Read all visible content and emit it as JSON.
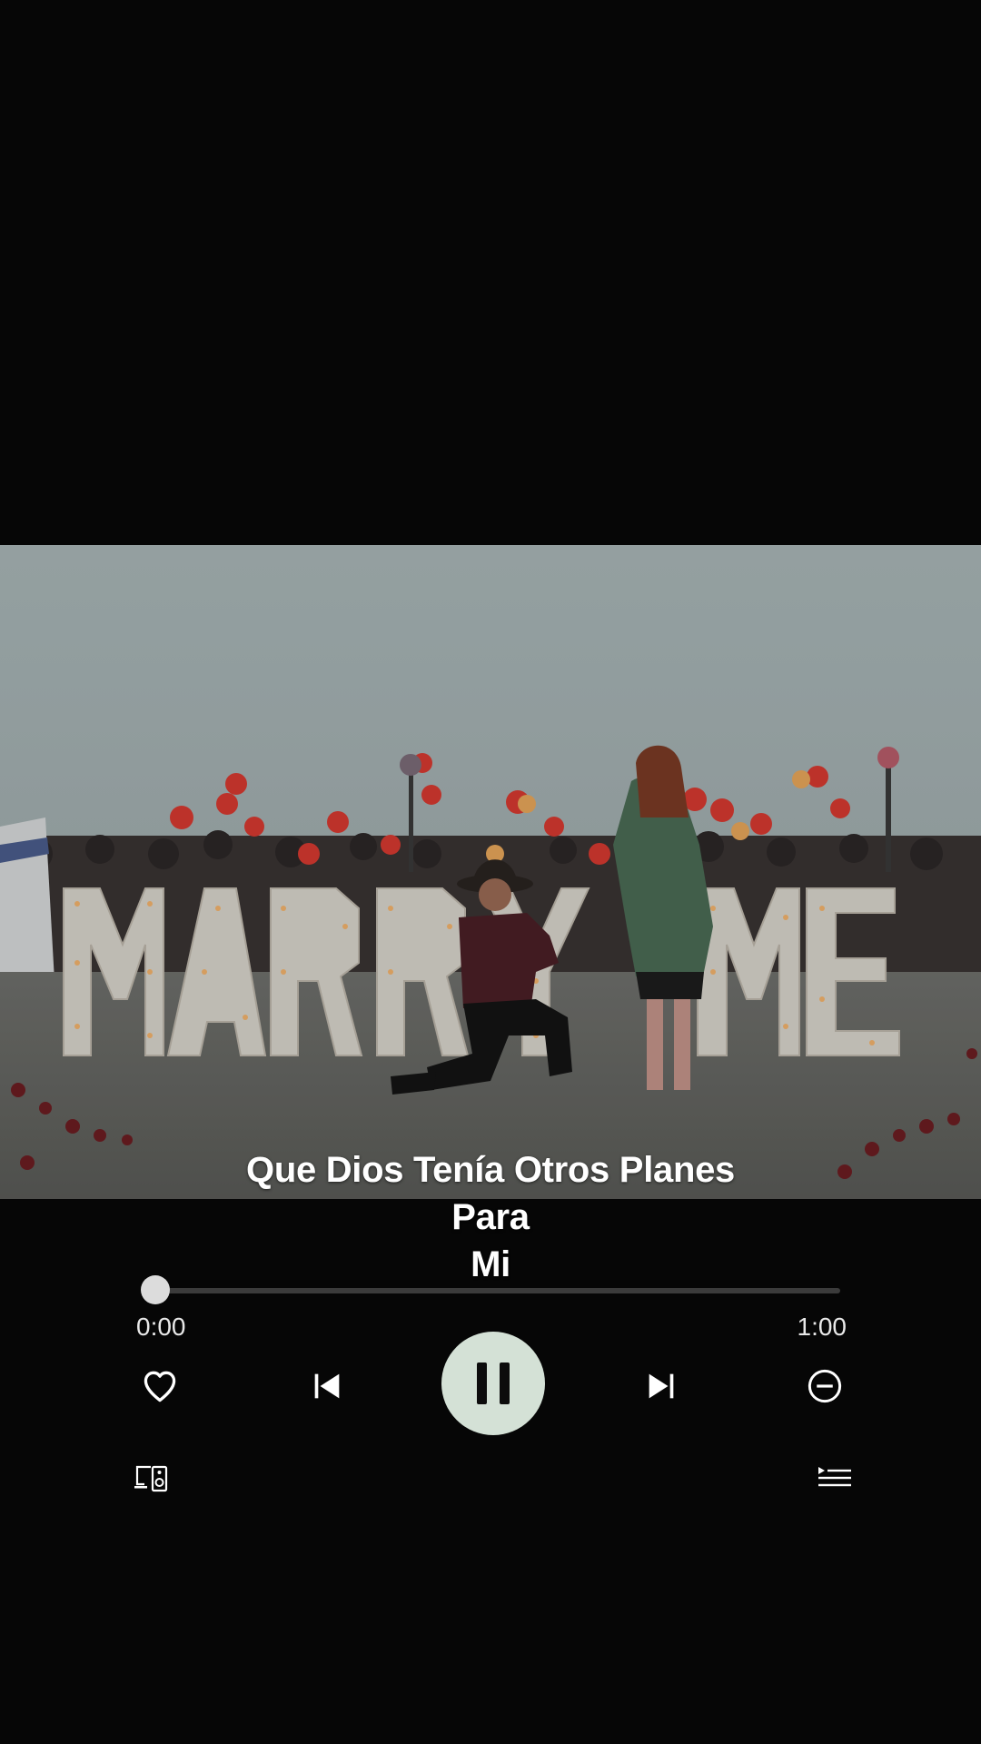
{
  "photo": {
    "sign_text": "MARRY ME",
    "description_icon": "proposal-photo"
  },
  "lyrics": {
    "lines": [
      "Que Dios Tenía Otros Planes",
      "Para",
      "Mi"
    ]
  },
  "player": {
    "progress": 0.0,
    "elapsed": "0:00",
    "total": "1:00",
    "is_playing": true
  },
  "controls": {
    "like_icon": "heart-icon",
    "prev_icon": "skip-previous-icon",
    "pause_icon": "pause-icon",
    "next_icon": "skip-next-icon",
    "hide_icon": "minus-circle-icon",
    "devices_icon": "devices-icon",
    "queue_icon": "queue-icon"
  },
  "colors": {
    "background": "#060606",
    "play_button": "#d4e1d6",
    "track": "#3b3b3b",
    "knob": "#dcdcdc"
  }
}
